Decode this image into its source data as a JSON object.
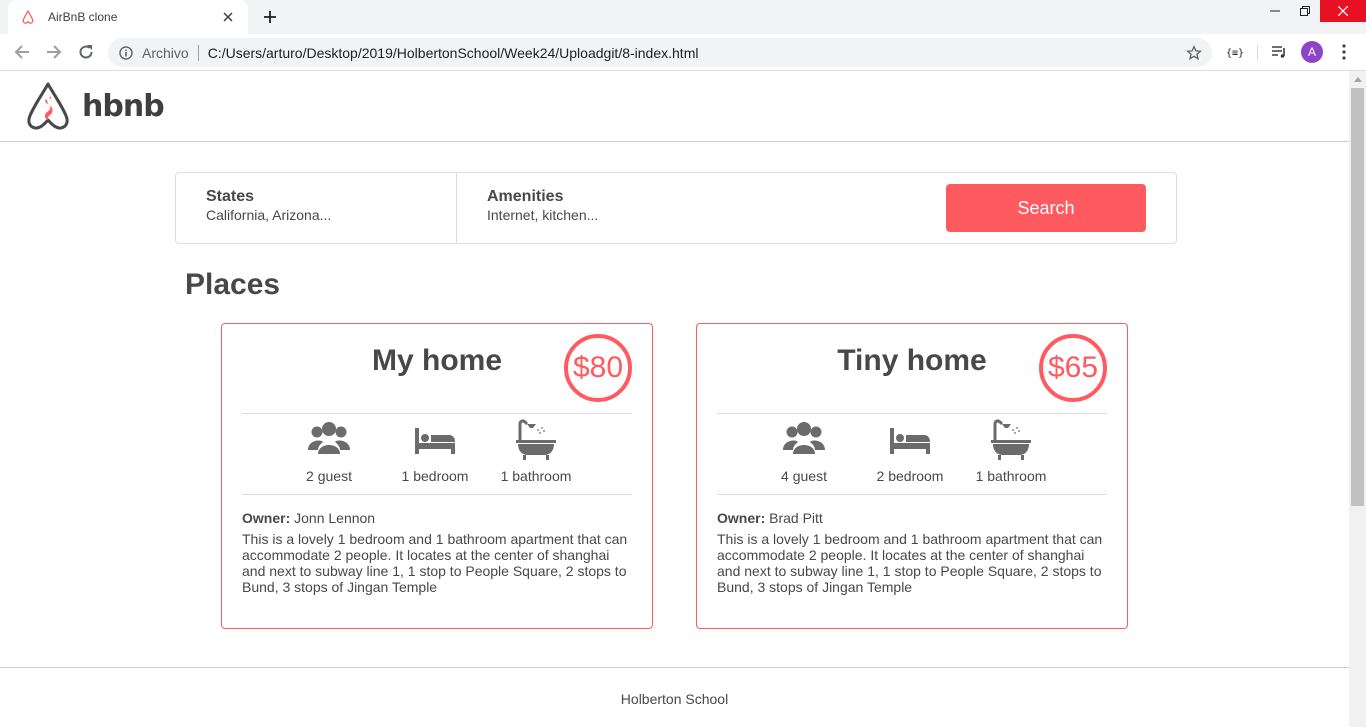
{
  "browser": {
    "tab_title": "AirBnB clone",
    "url_chip": "Archivo",
    "url": "C:/Users/arturo/Desktop/2019/HolbertonSchool/Week24/Uploadgit/8-index.html",
    "avatar_letter": "A",
    "icons": [
      "airbnb-favicon",
      "close-icon",
      "plus-icon",
      "minimize-icon",
      "restore-icon",
      "window-close-icon",
      "back-arrow-icon",
      "forward-arrow-icon",
      "reload-icon",
      "info-icon",
      "star-icon",
      "extension-icon",
      "media-queue-icon",
      "kebab-menu-icon"
    ]
  },
  "header": {
    "logo_text": "hbnb"
  },
  "filters": {
    "states_title": "States",
    "states_value": "California, Arizona...",
    "amenities_title": "Amenities",
    "amenities_value": "Internet, kitchen...",
    "search_label": "Search"
  },
  "places_title": "Places",
  "places": [
    {
      "name": "My home",
      "price": "$80",
      "guests": "2 guest",
      "bedrooms": "1 bedroom",
      "bathrooms": "1 bathroom",
      "owner_label": "Owner:",
      "owner": "Jonn Lennon",
      "description": "This is a lovely 1 bedroom and 1 bathroom apartment that can accommodate 2 people. It locates at the center of shanghai and next to subway line 1, 1 stop to People Square, 2 stops to Bund, 3 stops of Jingan Temple"
    },
    {
      "name": "Tiny home",
      "price": "$65",
      "guests": "4 guest",
      "bedrooms": "2 bedroom",
      "bathrooms": "1 bathroom",
      "owner_label": "Owner:",
      "owner": "Brad Pitt",
      "description": "This is a lovely 1 bedroom and 1 bathroom apartment that can accommodate 2 people. It locates at the center of shanghai and next to subway line 1, 1 stop to People Square, 2 stops to Bund, 3 stops of Jingan Temple"
    }
  ],
  "footer": {
    "text": "Holberton School"
  },
  "colors": {
    "accent": "#ff5a5f",
    "text": "#484848",
    "border": "#dddddd"
  }
}
